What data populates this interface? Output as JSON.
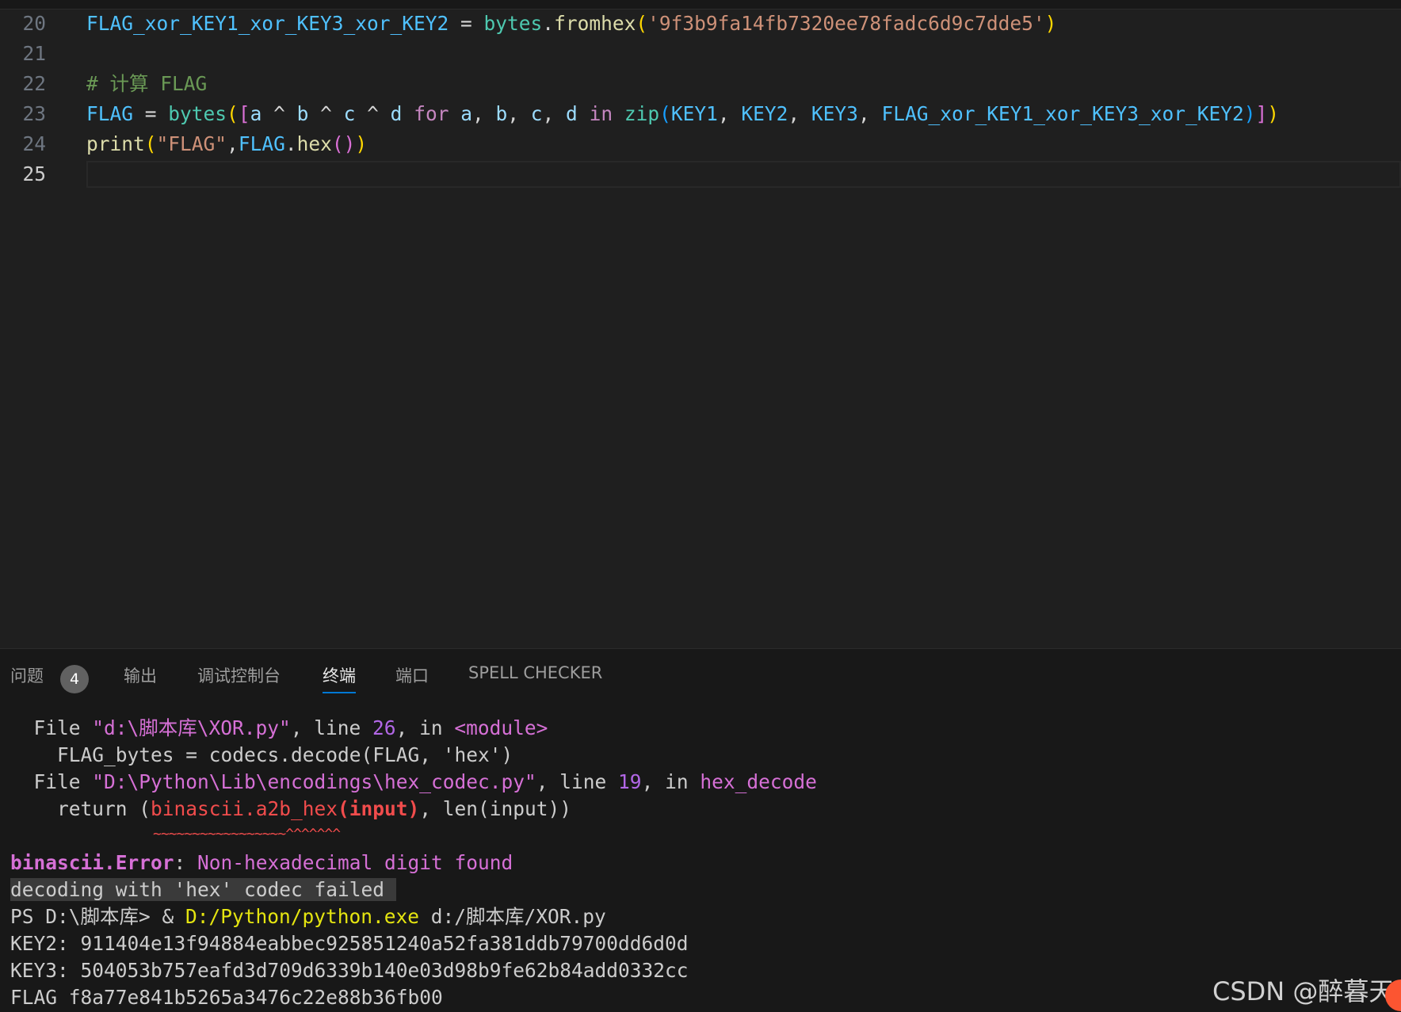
{
  "editor": {
    "lines": [
      {
        "num": "20",
        "tokens": [
          {
            "t": "FLAG_xor_KEY1_xor_KEY3_xor_KEY2",
            "c": "t-const"
          },
          {
            "t": " = ",
            "c": "t-op"
          },
          {
            "t": "bytes",
            "c": "t-cls"
          },
          {
            "t": ".",
            "c": "t-op"
          },
          {
            "t": "fromhex",
            "c": "t-fn"
          },
          {
            "t": "(",
            "c": "b1"
          },
          {
            "t": "'9f3b9fa14fb7320ee78fadc6d9c7dde5'",
            "c": "t-str"
          },
          {
            "t": ")",
            "c": "b1"
          }
        ]
      },
      {
        "num": "21",
        "tokens": []
      },
      {
        "num": "22",
        "tokens": [
          {
            "t": "# 计算 FLAG",
            "c": "t-cmt"
          }
        ]
      },
      {
        "num": "23",
        "tokens": [
          {
            "t": "FLAG",
            "c": "t-const"
          },
          {
            "t": " = ",
            "c": "t-op"
          },
          {
            "t": "bytes",
            "c": "t-cls"
          },
          {
            "t": "(",
            "c": "b1"
          },
          {
            "t": "[",
            "c": "b2"
          },
          {
            "t": "a",
            "c": "t-var"
          },
          {
            "t": " ^ ",
            "c": "t-op"
          },
          {
            "t": "b",
            "c": "t-var"
          },
          {
            "t": " ^ ",
            "c": "t-op"
          },
          {
            "t": "c",
            "c": "t-var"
          },
          {
            "t": " ^ ",
            "c": "t-op"
          },
          {
            "t": "d",
            "c": "t-var"
          },
          {
            "t": " for ",
            "c": "t-kw"
          },
          {
            "t": "a",
            "c": "t-var"
          },
          {
            "t": ", ",
            "c": "t-op"
          },
          {
            "t": "b",
            "c": "t-var"
          },
          {
            "t": ", ",
            "c": "t-op"
          },
          {
            "t": "c",
            "c": "t-var"
          },
          {
            "t": ", ",
            "c": "t-op"
          },
          {
            "t": "d",
            "c": "t-var"
          },
          {
            "t": " in ",
            "c": "t-kw"
          },
          {
            "t": "zip",
            "c": "t-cls"
          },
          {
            "t": "(",
            "c": "b3"
          },
          {
            "t": "KEY1",
            "c": "t-const"
          },
          {
            "t": ", ",
            "c": "t-op"
          },
          {
            "t": "KEY2",
            "c": "t-const"
          },
          {
            "t": ", ",
            "c": "t-op"
          },
          {
            "t": "KEY3",
            "c": "t-const"
          },
          {
            "t": ", ",
            "c": "t-op"
          },
          {
            "t": "FLAG_xor_KEY1_xor_KEY3_xor_KEY2",
            "c": "t-const"
          },
          {
            "t": ")",
            "c": "b3"
          },
          {
            "t": "]",
            "c": "b2"
          },
          {
            "t": ")",
            "c": "b1"
          }
        ]
      },
      {
        "num": "24",
        "tokens": [
          {
            "t": "print",
            "c": "t-fn"
          },
          {
            "t": "(",
            "c": "b1"
          },
          {
            "t": "\"FLAG\"",
            "c": "t-str"
          },
          {
            "t": ",",
            "c": "t-op"
          },
          {
            "t": "FLAG",
            "c": "t-const"
          },
          {
            "t": ".",
            "c": "t-op"
          },
          {
            "t": "hex",
            "c": "t-fn"
          },
          {
            "t": "(",
            "c": "b2"
          },
          {
            "t": ")",
            "c": "b2"
          },
          {
            "t": ")",
            "c": "b1"
          }
        ]
      },
      {
        "num": "25",
        "tokens": [],
        "active": true
      }
    ]
  },
  "panel": {
    "tabs": [
      {
        "label": "问题",
        "name": "tab-problems"
      },
      {
        "label": "输出",
        "name": "tab-output"
      },
      {
        "label": "调试控制台",
        "name": "tab-debug-console"
      },
      {
        "label": "终端",
        "name": "tab-terminal",
        "active": true
      },
      {
        "label": "端口",
        "name": "tab-ports"
      },
      {
        "label": "SPELL CHECKER",
        "name": "tab-spell-checker"
      }
    ],
    "problems_count": "4"
  },
  "terminal": {
    "lines": [
      [
        {
          "t": "  File ",
          "c": ""
        },
        {
          "t": "\"d:\\脚本库\\XOR.py\"",
          "c": "m-path"
        },
        {
          "t": ", line ",
          "c": ""
        },
        {
          "t": "26",
          "c": "m-num"
        },
        {
          "t": ", in ",
          "c": ""
        },
        {
          "t": "<module>",
          "c": "m-path"
        }
      ],
      [
        {
          "t": "    FLAG_bytes = codecs.decode(FLAG, 'hex')",
          "c": ""
        }
      ],
      [
        {
          "t": "  File ",
          "c": ""
        },
        {
          "t": "\"D:\\Python\\Lib\\encodings\\hex_codec.py\"",
          "c": "m-path"
        },
        {
          "t": ", line ",
          "c": ""
        },
        {
          "t": "19",
          "c": "m-num"
        },
        {
          "t": ", in ",
          "c": ""
        },
        {
          "t": "hex_decode",
          "c": "m-path"
        }
      ],
      [
        {
          "t": "    return (",
          "c": ""
        },
        {
          "t": "binascii.a2b_hex",
          "c": "m-red"
        },
        {
          "t": "(input)",
          "c": "m-redb"
        },
        {
          "t": ", len(input))",
          "c": ""
        }
      ],
      [],
      [
        {
          "t": "binascii.Error",
          "c": "m-errb"
        },
        {
          "t": ": ",
          "c": ""
        },
        {
          "t": "Non-hexadecimal digit found",
          "c": "m-path"
        }
      ],
      [
        {
          "t": "decoding with 'hex' codec failed ",
          "c": "hl"
        }
      ],
      [
        {
          "t": "PS D:\\脚本库> & ",
          "c": ""
        },
        {
          "t": "D:/Python/python.exe",
          "c": "m-yel"
        },
        {
          "t": " d:/脚本库/XOR.py",
          "c": ""
        }
      ],
      [
        {
          "t": "KEY2: 911404e13f94884eabbec925851240a52fa381ddb79700dd6d0d",
          "c": ""
        }
      ],
      [
        {
          "t": "KEY3: 504053b757eafd3d709d6339b140e03d98b9fe62b84add0332cc",
          "c": ""
        }
      ],
      [
        {
          "t": "FLAG f8a77e841b5265a3476c22e88b36fb00",
          "c": ""
        }
      ]
    ],
    "squiggle": "~~~~~~~~~~~~~~~~~^^^^^^^"
  },
  "watermark": "CSDN @醉暮天"
}
